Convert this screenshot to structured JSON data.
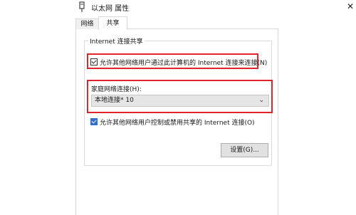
{
  "window": {
    "title": "以太网 属性",
    "close_glyph": "✕"
  },
  "tabs": [
    {
      "label": "网络"
    },
    {
      "label": "共享"
    }
  ],
  "sharing": {
    "group_label": "Internet 连接共享",
    "allow_others_connect": {
      "label": "允许其他网络用户通过此计算机的 Internet 连接来连接(N)",
      "checked": true
    },
    "home_network": {
      "label": "家庭网络连接(H):",
      "selected": "本地连接* 10",
      "arrow": "⌄"
    },
    "allow_others_control": {
      "label": "允许其他网络用户控制或禁用共享的 Internet 连接(O)",
      "checked": true
    },
    "settings_button": "设置(G)..."
  },
  "highlights": {
    "color": "#e0242a"
  },
  "accent": "#2f6fcf"
}
